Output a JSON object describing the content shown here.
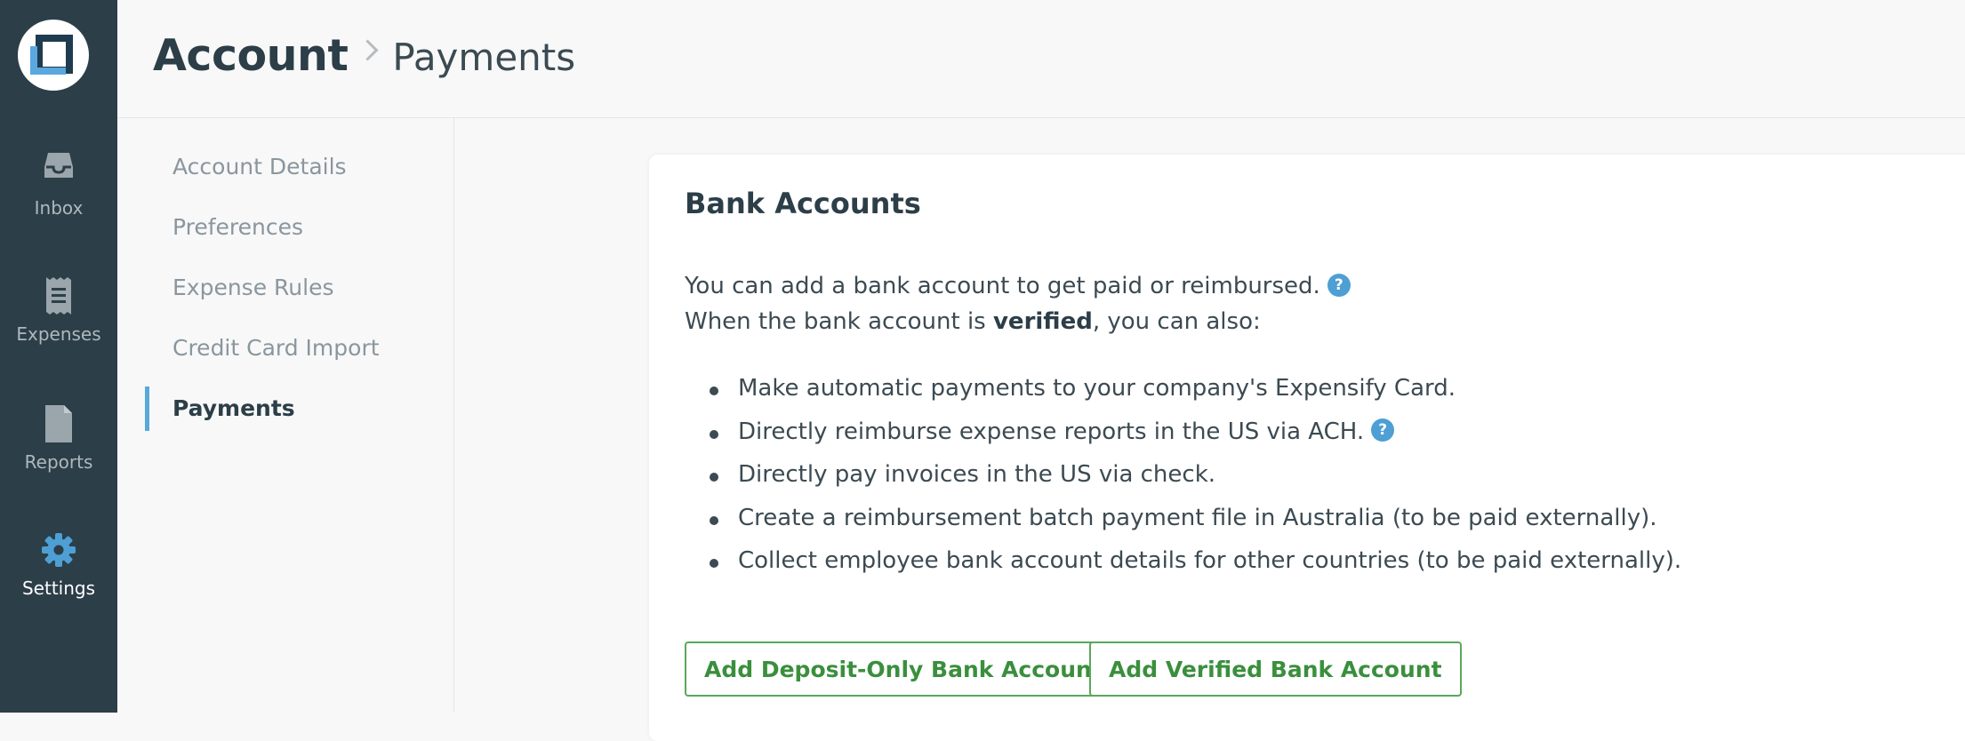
{
  "nav": {
    "items": [
      {
        "label": "Inbox",
        "icon": "inbox-icon"
      },
      {
        "label": "Expenses",
        "icon": "receipt-icon"
      },
      {
        "label": "Reports",
        "icon": "document-icon"
      },
      {
        "label": "Settings",
        "icon": "gear-icon",
        "active": true
      }
    ]
  },
  "header": {
    "root": "Account",
    "current": "Payments"
  },
  "submenu": {
    "items": [
      {
        "label": "Account Details"
      },
      {
        "label": "Preferences"
      },
      {
        "label": "Expense Rules"
      },
      {
        "label": "Credit Card Import"
      },
      {
        "label": "Payments",
        "active": true
      }
    ]
  },
  "card": {
    "title": "Bank Accounts",
    "line1": "You can add a bank account to get paid or reimbursed.",
    "line2_pre": "When the bank account is ",
    "line2_bold": "verified",
    "line2_post": ", you can also:",
    "help_glyph": "?",
    "bullets": [
      "Make automatic payments to your company's Expensify Card.",
      "Directly reimburse expense reports in the US via ACH.",
      "Directly pay invoices in the US via check.",
      "Create a reimbursement batch payment file in Australia (to be paid externally).",
      "Collect employee bank account details for other countries (to be paid externally)."
    ],
    "buttons": {
      "deposit_only": "Add Deposit-Only Bank Account",
      "verified": "Add Verified Bank Account"
    }
  },
  "colors": {
    "nav_bg": "#2c3e48",
    "accent_blue": "#59a9d9",
    "button_green": "#3a8f3d"
  }
}
